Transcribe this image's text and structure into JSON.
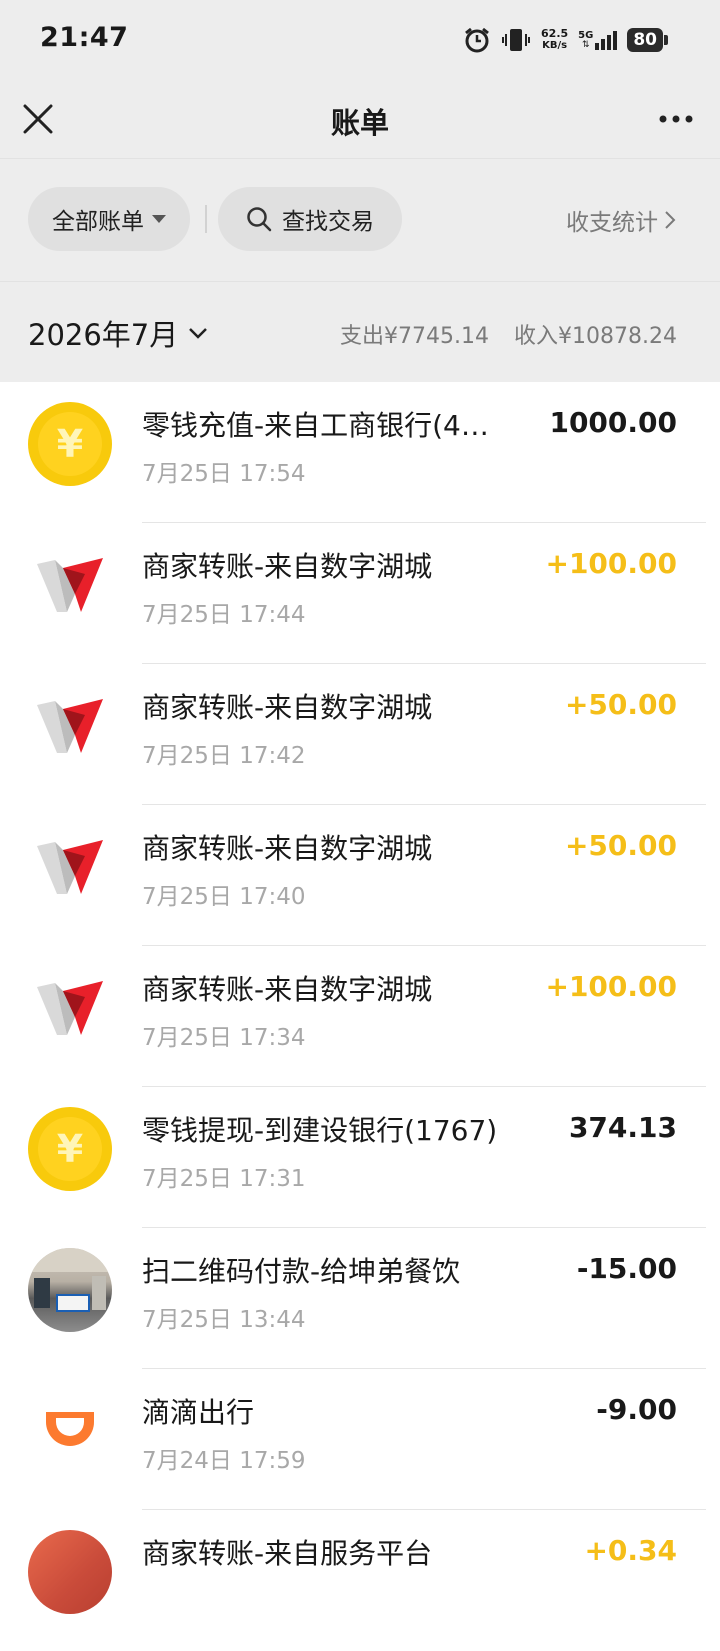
{
  "status_bar": {
    "time": "21:47",
    "net_speed": "62.5",
    "net_speed_unit": "KB/s",
    "net_type": "5G",
    "battery": "80"
  },
  "nav": {
    "title": "账单"
  },
  "filters": {
    "all_bills": "全部账单",
    "search": "查找交易",
    "stats": "收支统计"
  },
  "month": {
    "label": "2026年7月",
    "expense": "支出¥7745.14",
    "income": "收入¥10878.24"
  },
  "transactions": [
    {
      "icon": "coin-icon",
      "title": "零钱充值-来自工商银行(4…",
      "time": "7月25日 17:54",
      "amount": "1000.00",
      "type": "neutral"
    },
    {
      "icon": "merchant-logo-icon",
      "title": "商家转账-来自数字湖城",
      "time": "7月25日 17:44",
      "amount": "+100.00",
      "type": "income"
    },
    {
      "icon": "merchant-logo-icon",
      "title": "商家转账-来自数字湖城",
      "time": "7月25日 17:42",
      "amount": "+50.00",
      "type": "income"
    },
    {
      "icon": "merchant-logo-icon",
      "title": "商家转账-来自数字湖城",
      "time": "7月25日 17:40",
      "amount": "+50.00",
      "type": "income"
    },
    {
      "icon": "merchant-logo-icon",
      "title": "商家转账-来自数字湖城",
      "time": "7月25日 17:34",
      "amount": "+100.00",
      "type": "income"
    },
    {
      "icon": "coin-icon",
      "title": "零钱提现-到建设银行(1767)",
      "time": "7月25日 17:31",
      "amount": "374.13",
      "type": "neutral"
    },
    {
      "icon": "shop-photo-avatar",
      "title": "扫二维码付款-给坤弟餐饮",
      "time": "7月25日 13:44",
      "amount": "-15.00",
      "type": "expense"
    },
    {
      "icon": "didi-logo-icon",
      "title": "滴滴出行",
      "time": "7月24日 17:59",
      "amount": "-9.00",
      "type": "expense"
    },
    {
      "icon": "netcafe-avatar",
      "title": "商家转账-来自服务平台",
      "time": "",
      "amount": "+0.34",
      "type": "income"
    }
  ],
  "colors": {
    "income": "#f5be18",
    "coin": "#ffd21f",
    "merchant_red": "#e8202a",
    "didi_orange": "#fc7a2f"
  }
}
